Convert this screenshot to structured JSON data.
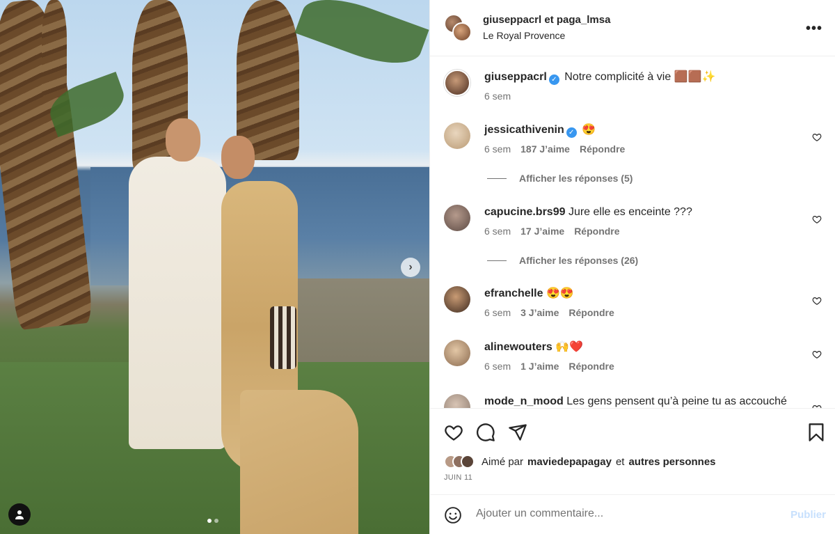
{
  "post": {
    "header_user": "giuseppacrl et paga_lmsa",
    "location": "Le Royal Provence"
  },
  "caption": {
    "username": "giuseppacrl",
    "text": "Notre complicité à vie 🟫🟫✨",
    "time": "6 sem"
  },
  "comments": [
    {
      "username": "jessicathivenin",
      "verified": true,
      "text": "😍",
      "time": "6 sem",
      "likes": "187 J’aime",
      "reply": "Répondre",
      "replies_label": "Afficher les réponses (5)"
    },
    {
      "username": "capucine.brs99",
      "verified": false,
      "text": "Jure elle es enceinte ???",
      "time": "6 sem",
      "likes": "17 J’aime",
      "reply": "Répondre",
      "replies_label": "Afficher les réponses (26)"
    },
    {
      "username": "efranchelle",
      "verified": false,
      "text": "😍😍",
      "time": "6 sem",
      "likes": "3 J’aime",
      "reply": "Répondre"
    },
    {
      "username": "alinewouters",
      "verified": false,
      "text": "🙌❤️",
      "time": "6 sem",
      "likes": "1 J’aime",
      "reply": "Répondre"
    },
    {
      "username": "mode_n_mood",
      "verified": false,
      "text": "Les gens pensent qu’à peine tu as accouché"
    }
  ],
  "likes": {
    "prefix": "Aimé par",
    "user": "maviedepapagay",
    "connector": "et",
    "others": "autres personnes"
  },
  "date": "JUIN 11",
  "compose": {
    "placeholder": "Ajouter un commentaire...",
    "publish_label": "Publier"
  },
  "colors": {
    "verified": "#3897f0",
    "publish_disabled": "#c7e0fd",
    "secondary_text": "#737373"
  },
  "carousel": {
    "current": 1,
    "total": 2
  }
}
